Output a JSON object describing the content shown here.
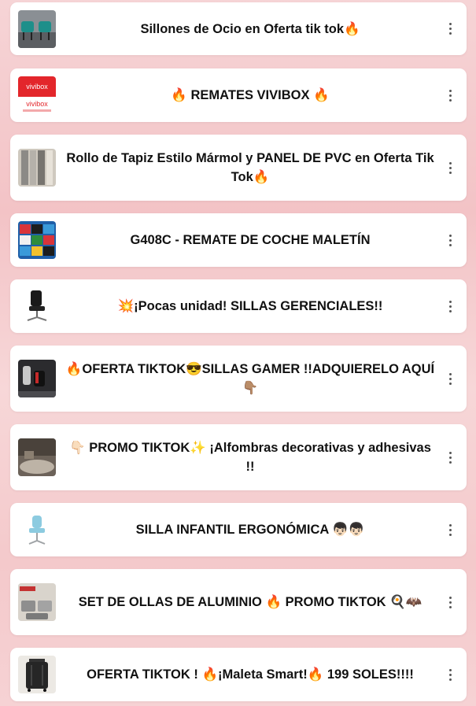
{
  "links": [
    {
      "title": "Sillones de Ocio en Oferta tik tok🔥",
      "thumb": "armchairs-thumbnail",
      "menu_icon": "kebab-menu-icon"
    },
    {
      "title": "🔥 REMATES VIVIBOX 🔥",
      "thumb": "vivibox-logo-thumbnail",
      "logo_text": "vivibox",
      "menu_icon": "kebab-menu-icon"
    },
    {
      "title": "Rollo de Tapiz Estilo Mármol y PANEL DE PVC en Oferta Tik Tok🔥",
      "thumb": "marble-wall-thumbnail",
      "menu_icon": "kebab-menu-icon"
    },
    {
      "title": "G408C - REMATE DE COCHE MALETÍN",
      "thumb": "stroller-collage-thumbnail",
      "menu_icon": "kebab-menu-icon"
    },
    {
      "title": "💥¡Pocas unidad! SILLAS GERENCIALES!!",
      "thumb": "office-chair-thumbnail",
      "menu_icon": "kebab-menu-icon"
    },
    {
      "title": "🔥OFERTA TIKTOK😎SILLAS GAMER !!ADQUIERELO AQUÍ👇🏽",
      "thumb": "gamer-chair-thumbnail",
      "menu_icon": "kebab-menu-icon"
    },
    {
      "title": "👇🏻 PROMO TIKTOK✨ ¡Alfombras decorativas y adhesivas !!",
      "thumb": "rug-room-thumbnail",
      "menu_icon": "kebab-menu-icon"
    },
    {
      "title": "SILLA INFANTIL ERGONÓMICA 👦🏻👦🏻",
      "thumb": "kids-chair-thumbnail",
      "menu_icon": "kebab-menu-icon"
    },
    {
      "title": "SET DE OLLAS DE ALUMINIO 🔥 PROMO TIKTOK 🍳🦇",
      "thumb": "pots-set-thumbnail",
      "menu_icon": "kebab-menu-icon"
    },
    {
      "title": "OFERTA TIKTOK ! 🔥¡Maleta Smart!🔥 199 SOLES!!!!",
      "thumb": "suitcase-thumbnail",
      "menu_icon": "kebab-menu-icon"
    }
  ]
}
